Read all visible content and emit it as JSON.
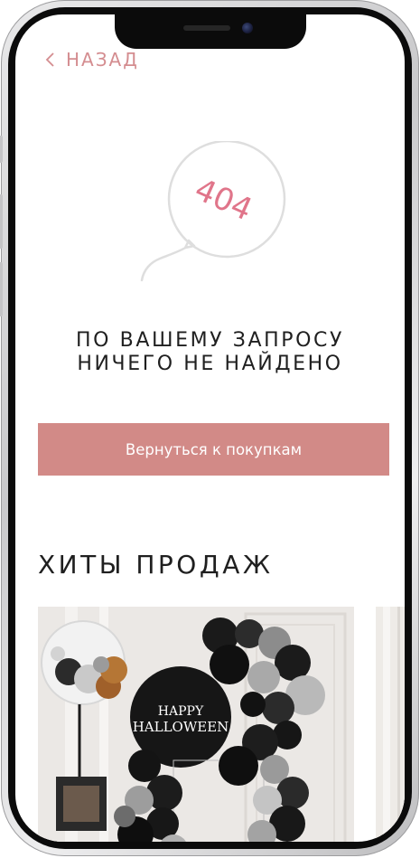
{
  "header": {
    "back_label": "НАЗАД"
  },
  "error": {
    "code": "404",
    "title_line1": "ПО ВАШЕМУ ЗАПРОСУ",
    "title_line2": "НИЧЕГО НЕ НАЙДЕНО"
  },
  "actions": {
    "return_label": "Вернуться к покупкам"
  },
  "bestsellers": {
    "title": "ХИТЫ ПРОДАЖ",
    "product_sign_line1": "HAPPY",
    "product_sign_line2": "HALLOWEEN"
  },
  "colors": {
    "accent": "#d28a87",
    "accent_text": "#d48d90",
    "text": "#1f1f1f",
    "error_code": "#e0758a"
  }
}
